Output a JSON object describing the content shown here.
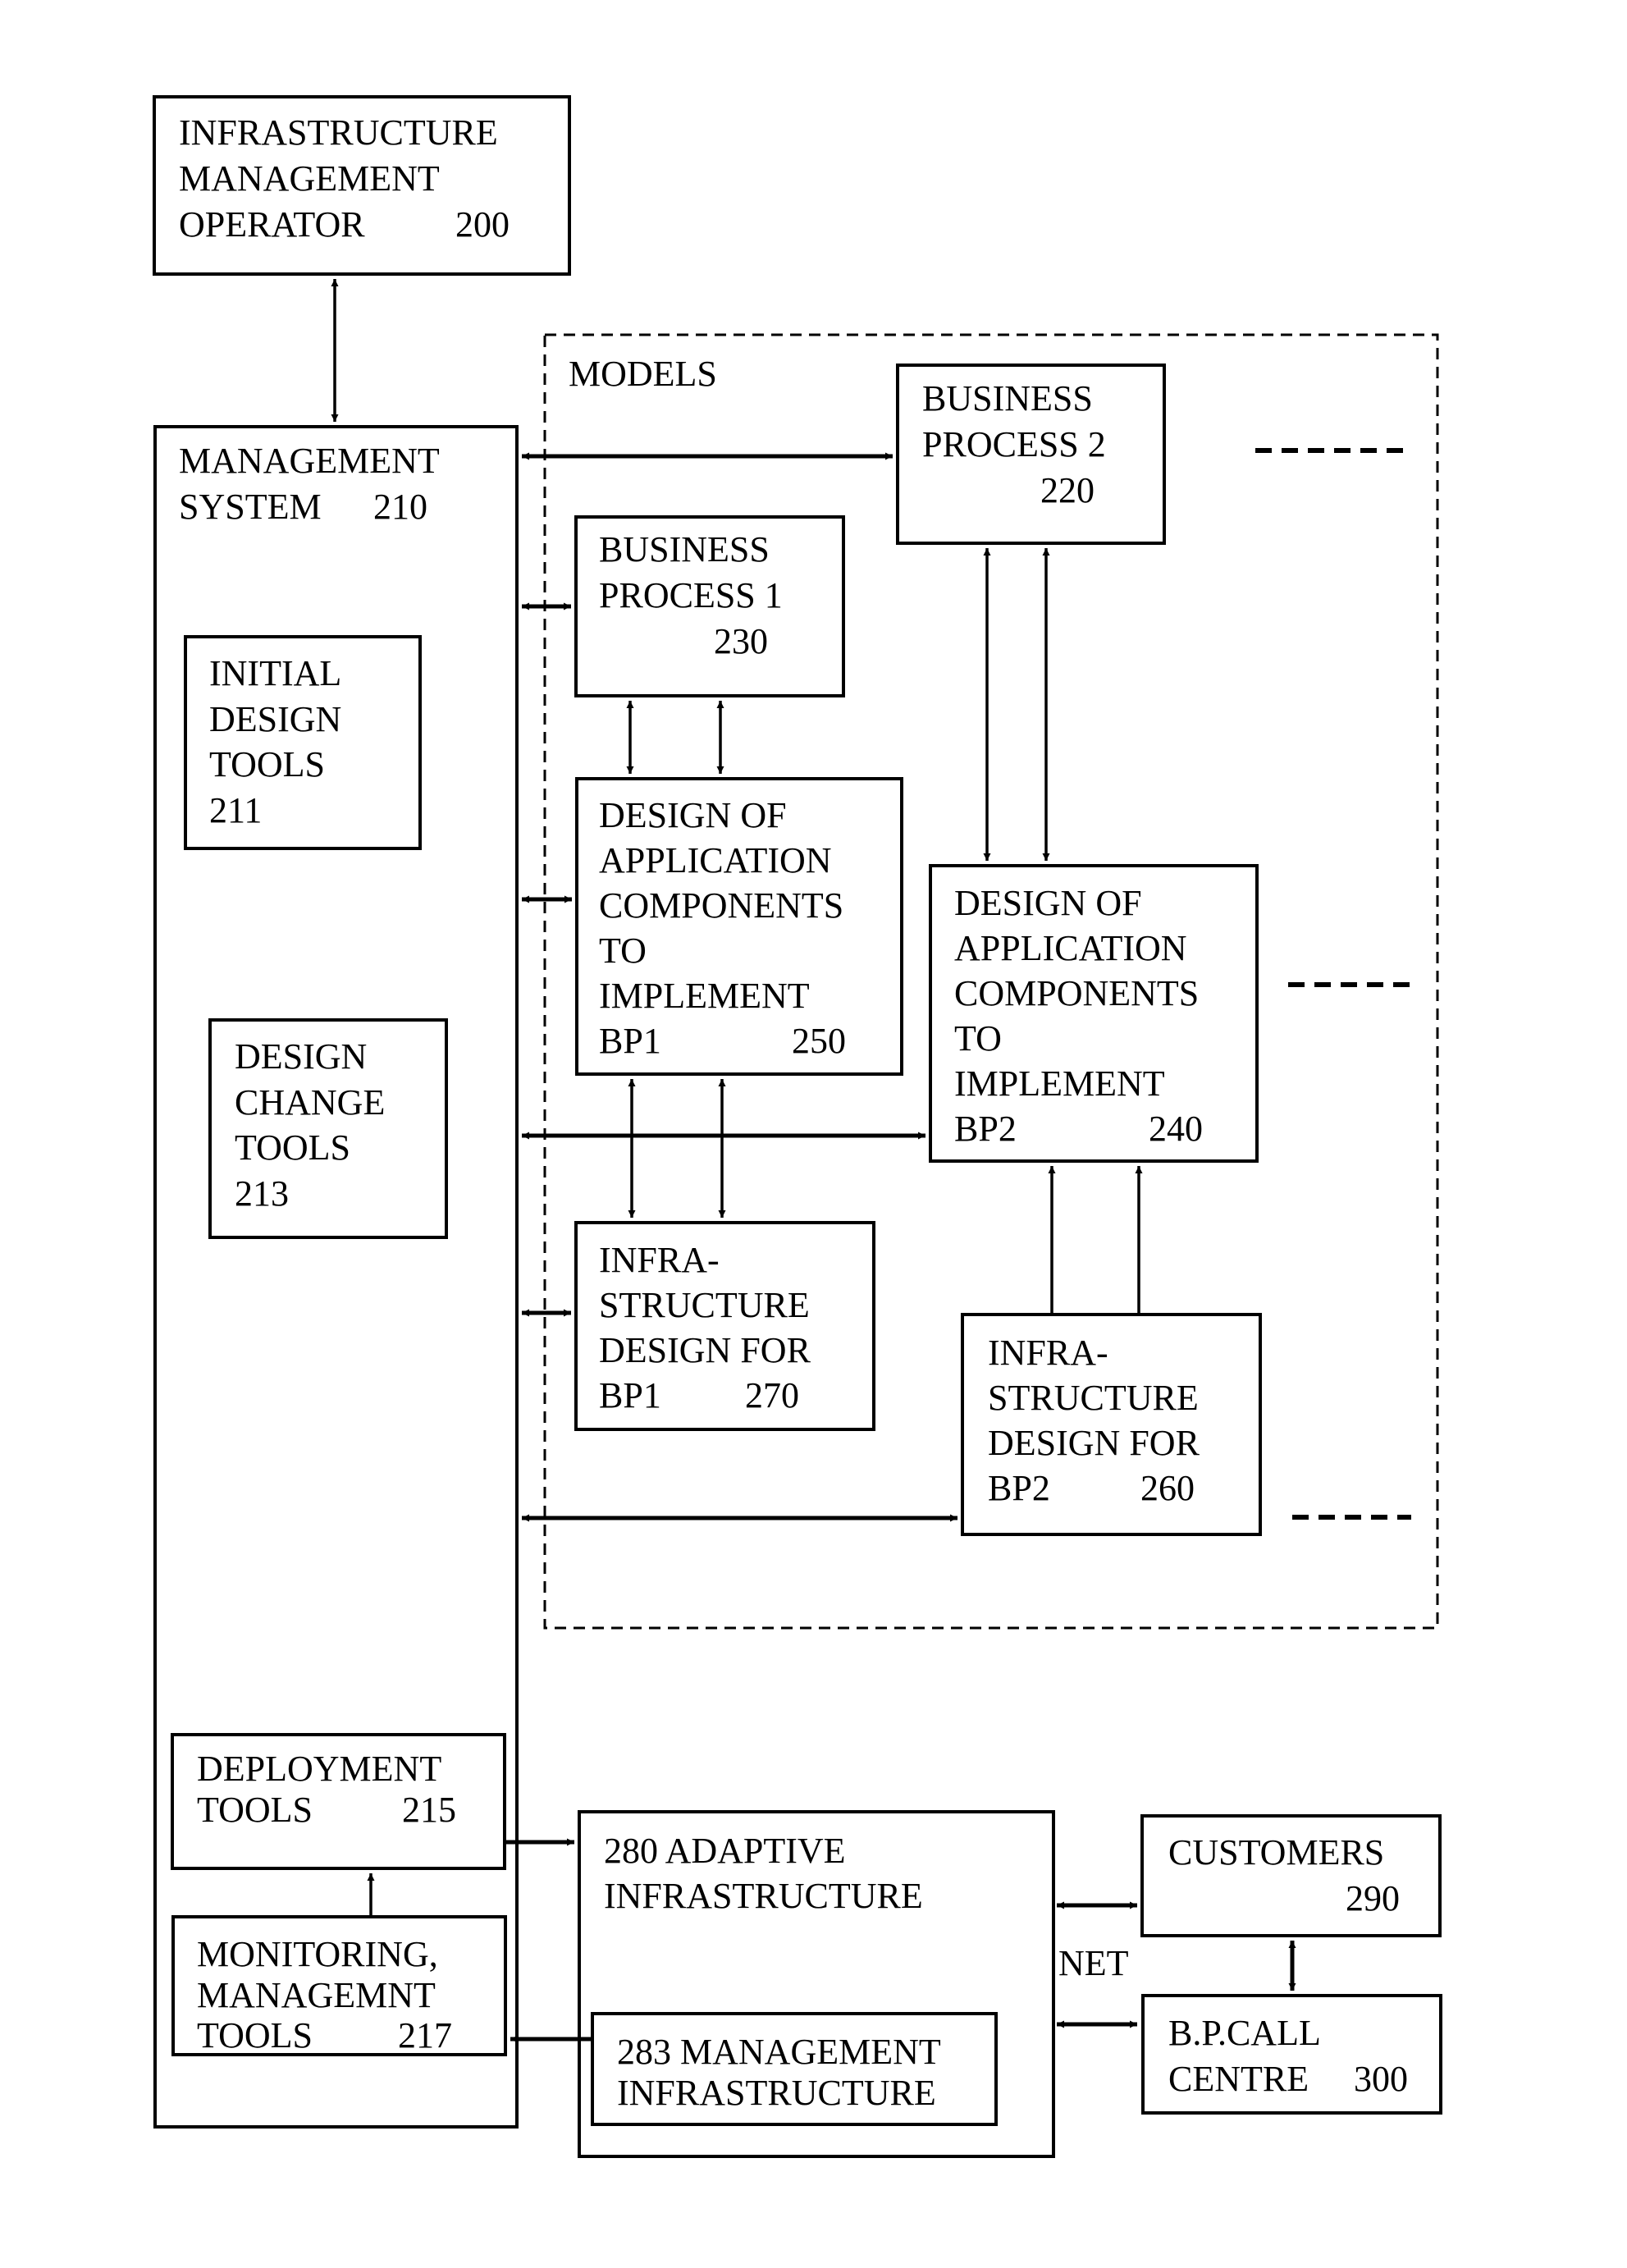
{
  "figure": {
    "operator": {
      "lines": [
        "INFRASTRUCTURE",
        "MANAGEMENT",
        "OPERATOR"
      ],
      "ref": "200"
    },
    "management_system": {
      "lines": [
        "MANAGEMENT",
        "SYSTEM"
      ],
      "ref": "210"
    },
    "initial_design_tools": {
      "lines": [
        "INITIAL",
        "DESIGN",
        "TOOLS",
        "211"
      ]
    },
    "design_change_tools": {
      "lines": [
        "DESIGN",
        "CHANGE",
        "TOOLS",
        "213"
      ]
    },
    "deployment_tools": {
      "lines": [
        "DEPLOYMENT",
        "TOOLS"
      ],
      "ref": "215"
    },
    "monitoring_tools": {
      "lines": [
        "MONITORING,",
        "MANAGEMNT",
        "TOOLS"
      ],
      "ref": "217"
    },
    "models": {
      "label": "MODELS"
    },
    "business_process_2": {
      "lines": [
        "BUSINESS",
        "PROCESS 2"
      ],
      "ref": "220"
    },
    "business_process_1": {
      "lines": [
        "BUSINESS",
        "PROCESS 1"
      ],
      "ref": "230"
    },
    "app_design_bp1": {
      "lines": [
        "DESIGN OF",
        "APPLICATION",
        "COMPONENTS",
        "TO",
        "IMPLEMENT",
        "BP1"
      ],
      "ref": "250"
    },
    "app_design_bp2": {
      "lines": [
        "DESIGN OF",
        "APPLICATION",
        "COMPONENTS",
        "TO",
        "IMPLEMENT",
        "BP2"
      ],
      "ref": "240"
    },
    "infra_design_bp1": {
      "lines": [
        "INFRA-",
        "STRUCTURE",
        "DESIGN FOR",
        "BP1"
      ],
      "ref": "270"
    },
    "infra_design_bp2": {
      "lines": [
        "INFRA-",
        "STRUCTURE",
        "DESIGN FOR",
        "BP2"
      ],
      "ref": "260"
    },
    "adaptive_infrastructure": {
      "lines": [
        "280 ADAPTIVE",
        "INFRASTRUCTURE"
      ]
    },
    "management_infrastructure": {
      "lines": [
        "283 MANAGEMENT",
        "INFRASTRUCTURE"
      ]
    },
    "customers": {
      "lines": [
        "CUSTOMERS"
      ],
      "ref": "290"
    },
    "call_centre": {
      "lines": [
        "B.P.CALL",
        "CENTRE"
      ],
      "ref": "300"
    },
    "net_label": "NET"
  }
}
